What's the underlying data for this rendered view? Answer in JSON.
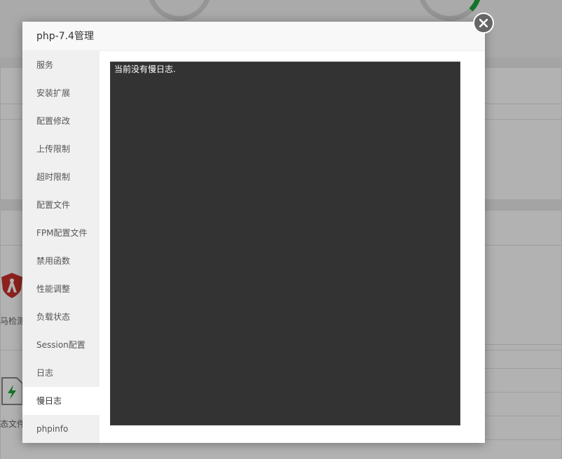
{
  "background": {
    "labels": {
      "malware_scan_partial": "马检测",
      "state_file_partial": "态文件"
    }
  },
  "modal": {
    "title": "php-7.4管理",
    "close_icon": "close-icon",
    "sidebar": {
      "items": [
        {
          "label": "服务"
        },
        {
          "label": "安装扩展"
        },
        {
          "label": "配置修改"
        },
        {
          "label": "上传限制"
        },
        {
          "label": "超时限制"
        },
        {
          "label": "配置文件"
        },
        {
          "label": "FPM配置文件"
        },
        {
          "label": "禁用函数"
        },
        {
          "label": "性能调整"
        },
        {
          "label": "负载状态"
        },
        {
          "label": "Session配置"
        },
        {
          "label": "日志"
        },
        {
          "label": "慢日志"
        },
        {
          "label": "phpinfo"
        }
      ],
      "active_index": 12
    },
    "log": {
      "text": "当前没有慢日志."
    }
  },
  "colors": {
    "log_background": "#333333",
    "accent_green": "#20a53a",
    "shield_red": "#c9302c"
  }
}
